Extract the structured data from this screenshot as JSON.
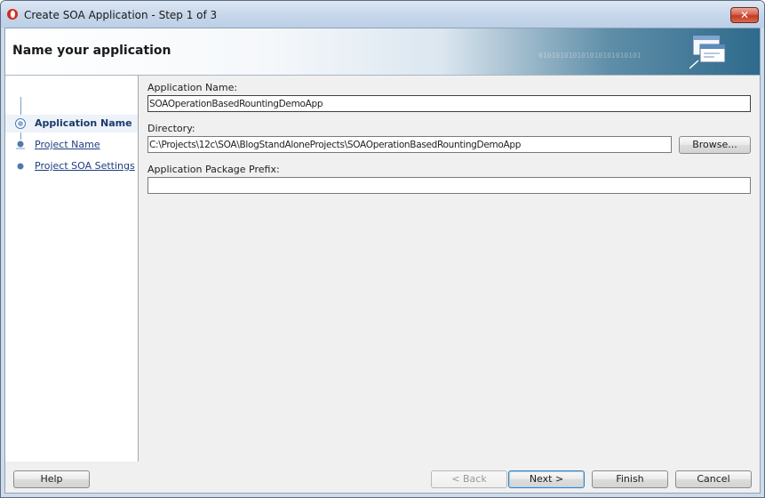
{
  "window": {
    "title": "Create SOA Application - Step 1 of 3",
    "close_label": "✕"
  },
  "banner": {
    "title": "Name your application",
    "binary_text": "010101010101010101010101"
  },
  "nav": {
    "items": [
      {
        "label": "Application Name",
        "active": true
      },
      {
        "label": "Project Name",
        "active": false
      },
      {
        "label": "Project SOA Settings",
        "active": false
      }
    ]
  },
  "form": {
    "app_name": {
      "label": "Application Name:",
      "value": "SOAOperationBasedRountingDemoApp"
    },
    "directory": {
      "label": "Directory:",
      "value": "C:\\Projects\\12c\\SOA\\BlogStandAloneProjects\\SOAOperationBasedRountingDemoApp",
      "browse_label": "Browse..."
    },
    "package_prefix": {
      "label": "Application Package Prefix:",
      "value": ""
    }
  },
  "buttons": {
    "help": "Help",
    "back": "< Back",
    "next": "Next >",
    "finish": "Finish",
    "cancel": "Cancel"
  },
  "colors": {
    "accent": "#1d3d80",
    "close": "#c23b22"
  }
}
